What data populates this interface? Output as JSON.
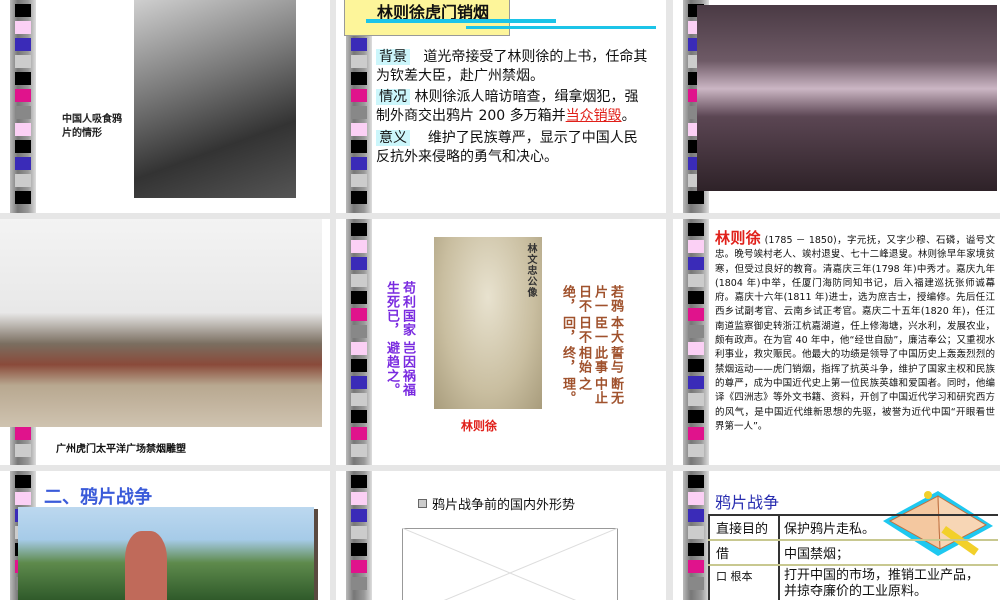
{
  "slides": [
    {
      "caption": "中国人吸食鸦片的情形"
    },
    {
      "title": "林则徐虎门销烟",
      "rows": [
        {
          "label": "背景",
          "text": "道光帝接受了林则徐的上书，任命其为钦差大臣，赴广州禁烟。"
        },
        {
          "label": "情况",
          "text": "林则徐派人暗访暗查，缉拿烟犯，强制外商交出鸦片 200 多万箱并",
          "highlight": "当众销毁",
          "end": "。"
        },
        {
          "label": "意义",
          "text": "维护了民族尊严，显示了中国人民反抗外来侵略的勇气和决心。"
        }
      ]
    },
    {
      "caption": ""
    },
    {
      "caption": "广州虎门太平洋广场禁烟雕塑"
    },
    {
      "name": "林则徐",
      "left_lines": [
        "岂因祸福避趋之。",
        "苟利国家生死已，"
      ],
      "right_lines": [
        "若鸦片一日不绝，",
        "本大臣一日不回，",
        "誓与此事相始终，",
        "断无中止之理。"
      ],
      "portrait_inscription": "林文忠公像"
    },
    {
      "name": "林则徐",
      "body": "(1785 － 1850)，字元抚，又字少穆、石磷，谥号文忠。晚号竢村老人、竢村退叟、七十二峰退叟。林则徐早年家境贫寒，但受过良好的教育。清嘉庆三年(1798 年)中秀才。嘉庆九年(1804 年)中举，任厦门海防同知书记，后入福建巡抚张师诚幕府。嘉庆十六年(1811 年)进士，选为庶吉士，授编修。先后任江西乡试副考官、云南乡试正考官。嘉庆二十五年(1820 年)，任江南道监察御史转浙江杭嘉湖道，任上修海塘，兴水利，发展农业，颇有政声。在为官 40 年中，他“经世自励”，廉洁奉公；又重视水利事业，救灾赈民。他最大的功绩是领导了中国历史上轰轰烈烈的禁烟运动——虎门销烟，指挥了抗英斗争，维护了国家主权和民族的尊严，成为中国近代史上第一位民族英雄和爱国者。同时，他编译《四洲志》等外文书籍、资料，开创了中国近代学习和研究西方的风气，是中国近代维新思想的先驱，被誉为近代中国“开眼看世界第一人”。"
    },
    {
      "title": "二、鸦片战争"
    },
    {
      "bullet": "鸦片战争前的国内外形势"
    },
    {
      "title": "鸦片战争",
      "table": [
        {
          "k": "直接目的",
          "v": "保护鸦片走私。"
        },
        {
          "k": "借",
          "v": "中国禁烟；"
        },
        {
          "k": "口 根本",
          "v": "打开中国的市场，推销工业产品，并掠夺廉价的工业原料。"
        }
      ]
    }
  ],
  "colors": {
    "stripe": [
      "#000",
      "#fbd0f5",
      "#3a2bb8",
      "#ccc",
      "#e0138c",
      "#888"
    ],
    "accent_red": "#e0201a",
    "title_blue": "#3a5bd9",
    "purple": "#7a2be0",
    "brown": "#a0522d"
  }
}
